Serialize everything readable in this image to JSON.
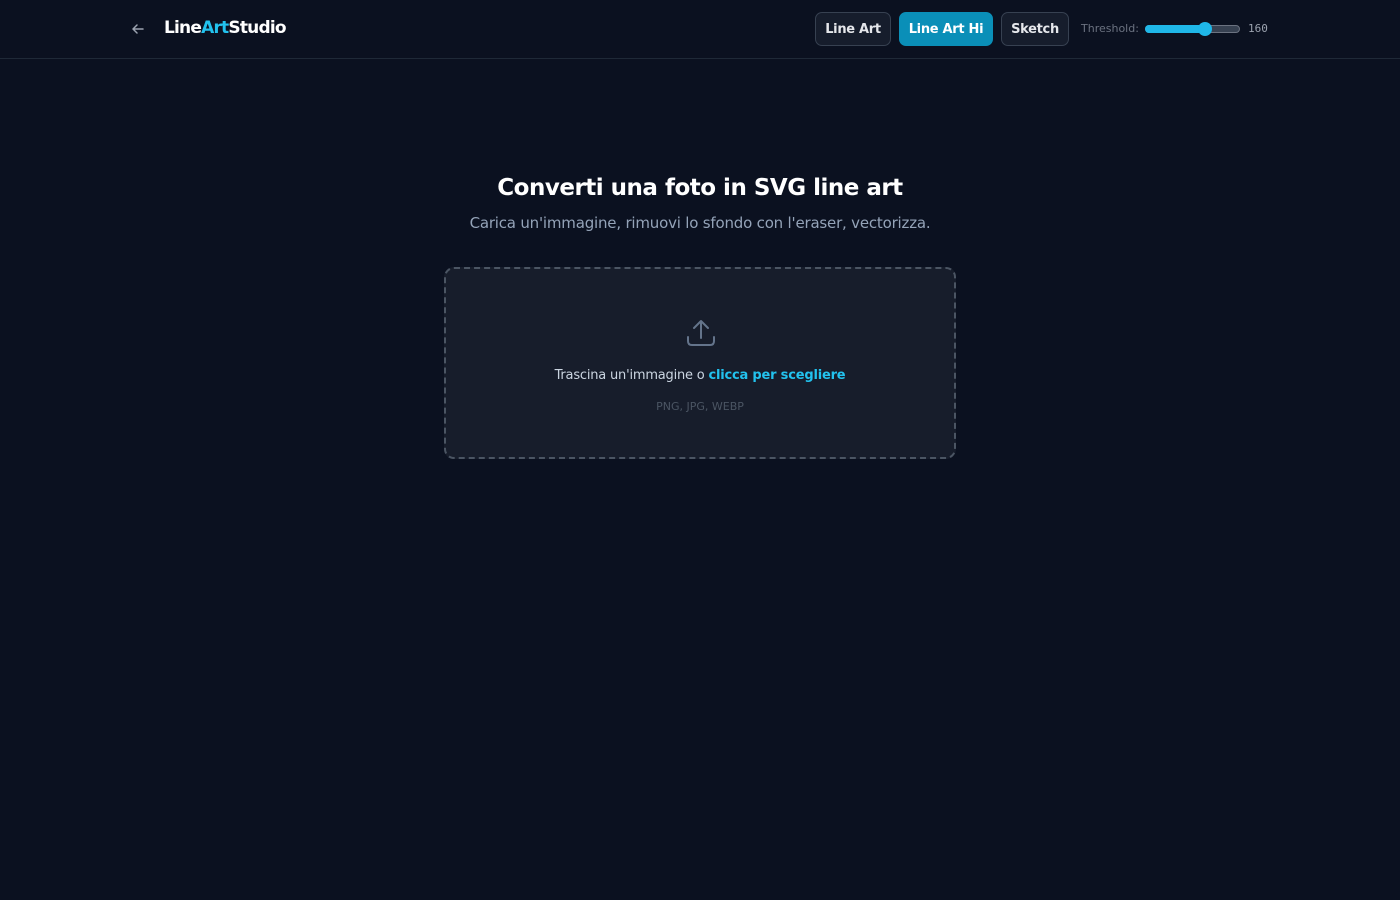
{
  "app": {
    "logo_part1": "Line",
    "logo_part2": "Art",
    "logo_part3": "Studio"
  },
  "modes": [
    {
      "label": "Line Art",
      "active": false
    },
    {
      "label": "Line Art Hi",
      "active": true
    },
    {
      "label": "Sketch",
      "active": false
    }
  ],
  "threshold": {
    "label": "Threshold:",
    "value": "160",
    "fraction": 0.63
  },
  "hero": {
    "title": "Converti una foto in SVG line art",
    "subtitle": "Carica un'immagine, rimuovi lo sfondo con l'eraser, vectorizza."
  },
  "dropzone": {
    "text": "Trascina un'immagine o",
    "link": "clicca per scegliere",
    "formats": "PNG, JPG, WEBP"
  },
  "icons": {
    "back": "arrow-left-icon",
    "upload": "upload-icon"
  },
  "colors": {
    "background": "#0b1120",
    "accent": "#22c2ee",
    "active_button": "#0a8fb8"
  }
}
